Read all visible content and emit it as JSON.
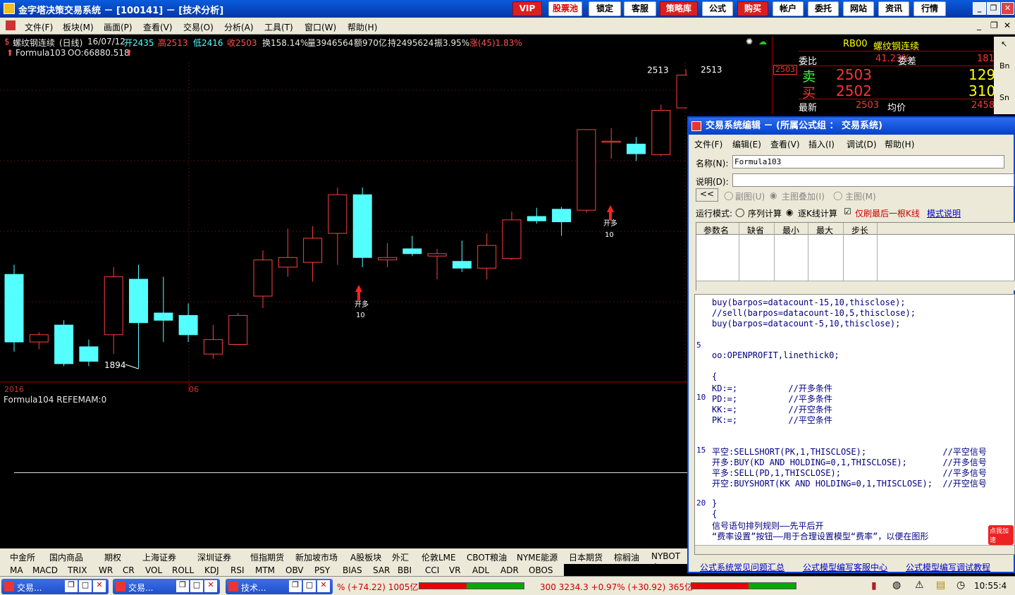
{
  "app": {
    "title": "金字塔决策交易系统 － [100141] － [技术分析]"
  },
  "topbuttons": [
    "VIP",
    "股票池",
    "锁定",
    "客服",
    "策略库",
    "公式",
    "购买",
    "帐户",
    "委托",
    "网站",
    "资讯",
    "行情"
  ],
  "menu": [
    "文件(F)",
    "板块(M)",
    "画面(P)",
    "查看(V)",
    "交易(O)",
    "分析(A)",
    "工具(T)",
    "窗口(W)",
    "帮助(H)"
  ],
  "info": {
    "name": "螺纹钢连续",
    "period": "(日线)",
    "date": "16/07/12",
    "open": "开2435",
    "high": "高2513",
    "low": "低2416",
    "close": "收2503",
    "turnover": "换158.14%",
    "volume": "量3946564",
    "amount": "额970亿",
    "position": "持2495624",
    "amplitude": "振3.95%",
    "change": "涨(45)1.83%",
    "formula": "Formula103",
    "oo": "OO:66880.518"
  },
  "chart": {
    "high_label": "2513",
    "low_label": "1894",
    "price_tag": "2503",
    "signal1_a": "开多",
    "signal1_b": "10",
    "signal2_a": "开多",
    "signal2_b": "10",
    "year_label": "2016",
    "month_label": "06"
  },
  "chart_data": {
    "type": "candlestick",
    "series": [
      {
        "o": 2090,
        "h": 2110,
        "l": 1930,
        "c": 1950
      },
      {
        "o": 1950,
        "h": 1970,
        "l": 1935,
        "c": 1965
      },
      {
        "o": 1985,
        "h": 1995,
        "l": 1900,
        "c": 1905
      },
      {
        "o": 1940,
        "h": 1955,
        "l": 1900,
        "c": 1910
      },
      {
        "o": 1965,
        "h": 2105,
        "l": 1925,
        "c": 2085
      },
      {
        "o": 2080,
        "h": 2110,
        "l": 1894,
        "c": 1990
      },
      {
        "o": 2010,
        "h": 2085,
        "l": 1950,
        "c": 1995
      },
      {
        "o": 2005,
        "h": 2030,
        "l": 1950,
        "c": 1965
      },
      {
        "o": 1925,
        "h": 1985,
        "l": 1915,
        "c": 1955
      },
      {
        "o": 1945,
        "h": 2010,
        "l": 1945,
        "c": 2005
      },
      {
        "o": 2045,
        "h": 2140,
        "l": 2020,
        "c": 2120
      },
      {
        "o": 2105,
        "h": 2185,
        "l": 2085,
        "c": 2125
      },
      {
        "o": 2115,
        "h": 2190,
        "l": 2075,
        "c": 2165
      },
      {
        "o": 2175,
        "h": 2270,
        "l": 2110,
        "c": 2255
      },
      {
        "o": 2255,
        "h": 2270,
        "l": 2105,
        "c": 2125
      },
      {
        "o": 2120,
        "h": 2155,
        "l": 2105,
        "c": 2125
      },
      {
        "o": 2143,
        "h": 2170,
        "l": 2128,
        "c": 2133
      },
      {
        "o": 2128,
        "h": 2143,
        "l": 2080,
        "c": 2133
      },
      {
        "o": 2117,
        "h": 2160,
        "l": 2095,
        "c": 2103
      },
      {
        "o": 2103,
        "h": 2175,
        "l": 2080,
        "c": 2150
      },
      {
        "o": 2123,
        "h": 2220,
        "l": 2120,
        "c": 2203
      },
      {
        "o": 2210,
        "h": 2228,
        "l": 2195,
        "c": 2201
      },
      {
        "o": 2225,
        "h": 2230,
        "l": 2170,
        "c": 2199
      },
      {
        "o": 2223,
        "h": 2390,
        "l": 2218,
        "c": 2390
      },
      {
        "o": 2365,
        "h": 2393,
        "l": 2330,
        "c": 2366
      },
      {
        "o": 2360,
        "h": 2375,
        "l": 2325,
        "c": 2340
      },
      {
        "o": 2338,
        "h": 2442,
        "l": 2335,
        "c": 2430
      }
    ],
    "sub_title": "Formula104 REFEMAM:0"
  },
  "quote": {
    "symbol": "RB00",
    "name": "螺纹钢连续",
    "weibi_label": "委比",
    "weibi": "41.23%",
    "weicha_label": "委差",
    "weicha": "181",
    "sell_label": "卖",
    "sell_price": "2503",
    "sell_vol": "129",
    "buy_label": "买",
    "buy_price": "2502",
    "buy_vol": "310",
    "last_label": "最新",
    "last": "2503",
    "avg_label": "均价",
    "avg": "2458"
  },
  "rstrip": [
    "Bn",
    "Sn"
  ],
  "editor": {
    "title": "交易系统编辑 － (所属公式组 ： 交易系统)",
    "menu": [
      "文件(F)",
      "编辑(E)",
      "查看(V)",
      "插入(I)",
      "调试(D)",
      "帮助(H)"
    ],
    "name_label": "名称(N):",
    "name_value": "Formula103",
    "desc_label": "说明(D):",
    "desc_value": "",
    "back_label": "<<",
    "opt1": "副图(U)",
    "opt2": "主图叠加(I)",
    "opt3": "主图(M)",
    "mode_label": "运行模式:",
    "mode1": "序列计算",
    "mode2": "逐K线计算",
    "refresh": "仅刷最后一根K线",
    "model_link": "模式说明",
    "param_headers": [
      "参数名",
      "缺省",
      "最小",
      "最大",
      "步长"
    ],
    "code": [
      {
        "t": "buy(barpos=datacount-15,10,thisclose);",
        "c": "kw"
      },
      {
        "t": "//sell(barpos=datacount-10,5,thisclose);",
        "c": "kw"
      },
      {
        "t": "buy(barpos=datacount-5,10,thisclose);",
        "c": "kw"
      },
      {
        "t": "",
        "c": ""
      },
      {
        "t": "",
        "c": ""
      },
      {
        "t": "oo:OPENPROFIT,linethick0;",
        "c": "kw"
      },
      {
        "t": "",
        "c": ""
      },
      {
        "t": "{",
        "c": "cn"
      },
      {
        "t": "KD:=;          //开多条件",
        "c": "cn"
      },
      {
        "t": "PD:=;          //平多条件",
        "c": "cn"
      },
      {
        "t": "KK:=;          //开空条件",
        "c": "cn"
      },
      {
        "t": "PK:=;          //平空条件",
        "c": "cn"
      },
      {
        "t": "",
        "c": ""
      },
      {
        "t": "",
        "c": ""
      },
      {
        "t": "平空:SELLSHORT(PK,1,THISCLOSE);               //平空信号",
        "c": "cn"
      },
      {
        "t": "开多:BUY(KD AND HOLDING=0,1,THISCLOSE);       //开多信号",
        "c": "cn"
      },
      {
        "t": "平多:SELL(PD,1,THISCLOSE);                    //平多信号",
        "c": "cn"
      },
      {
        "t": "开空:BUYSHORT(KK AND HOLDING=0,1,THISCLOSE);  //开空信号",
        "c": "cn"
      },
      {
        "t": "",
        "c": ""
      },
      {
        "t": "}",
        "c": "cn"
      },
      {
        "t": "{",
        "c": "cn"
      },
      {
        "t": "信号语句排列规则——先平后开",
        "c": "cn"
      },
      {
        "t": "“费率设置”按钮——用于合理设置模型“费率”，以便在图形",
        "c": "cn"
      }
    ],
    "line_numbers": [
      "5",
      "10",
      "15",
      "20"
    ],
    "links": [
      "公式系统常见问题汇总",
      "公式模型编写客服中心",
      "公式模型编写调试教程"
    ],
    "speed_badge": "点我加速"
  },
  "tabs": [
    "中金所",
    "国内商品",
    "期权",
    "上海证券",
    "深圳证券",
    "恒指期货",
    "新加坡市场",
    "A股板块",
    "外汇",
    "伦敦LME",
    "CBOT粮油",
    "NYME能源",
    "日本期货",
    "棕榈油",
    "NYBOT商"
  ],
  "tabs2": [
    "MA",
    "MACD",
    "TRIX",
    "WR",
    "CR",
    "VOL",
    "ROLL",
    "KDJ",
    "RSI",
    "MTM",
    "OBV",
    "PSY",
    "BIAS",
    "SAR",
    "BBI",
    "CCI",
    "VR",
    "ADL",
    "ADR",
    "OBOS"
  ],
  "taskbar": [
    "交易...",
    "交易...",
    "技术..."
  ],
  "status": {
    "idx1": "% (+74.22) 1005亿",
    "idx2": "300  3234.3 +0.97% (+30.92) 365亿",
    "time": "10:55:4"
  }
}
